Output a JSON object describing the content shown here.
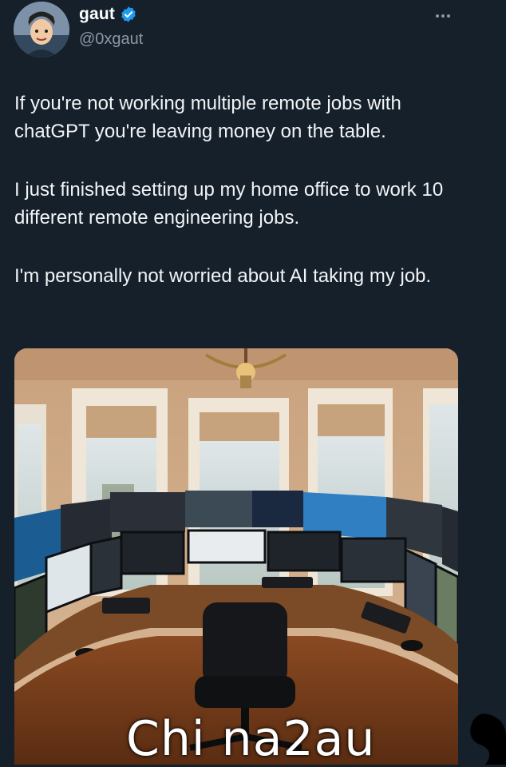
{
  "tweet": {
    "display_name": "gaut",
    "handle": "@0xgaut",
    "paragraphs": [
      "If you're not working multiple remote jobs with chatGPT you're leaving money on the table.",
      "I just finished setting up my home office to work 10 different remote engineering jobs.",
      "I'm personally not worried about AI taking my job."
    ]
  },
  "watermark": "Chi na2au",
  "colors": {
    "background": "#15202b",
    "verified": "#1d9bf0",
    "handle": "#8b98a5"
  },
  "icons": [
    "verified-badge-icon",
    "more-options-icon"
  ]
}
